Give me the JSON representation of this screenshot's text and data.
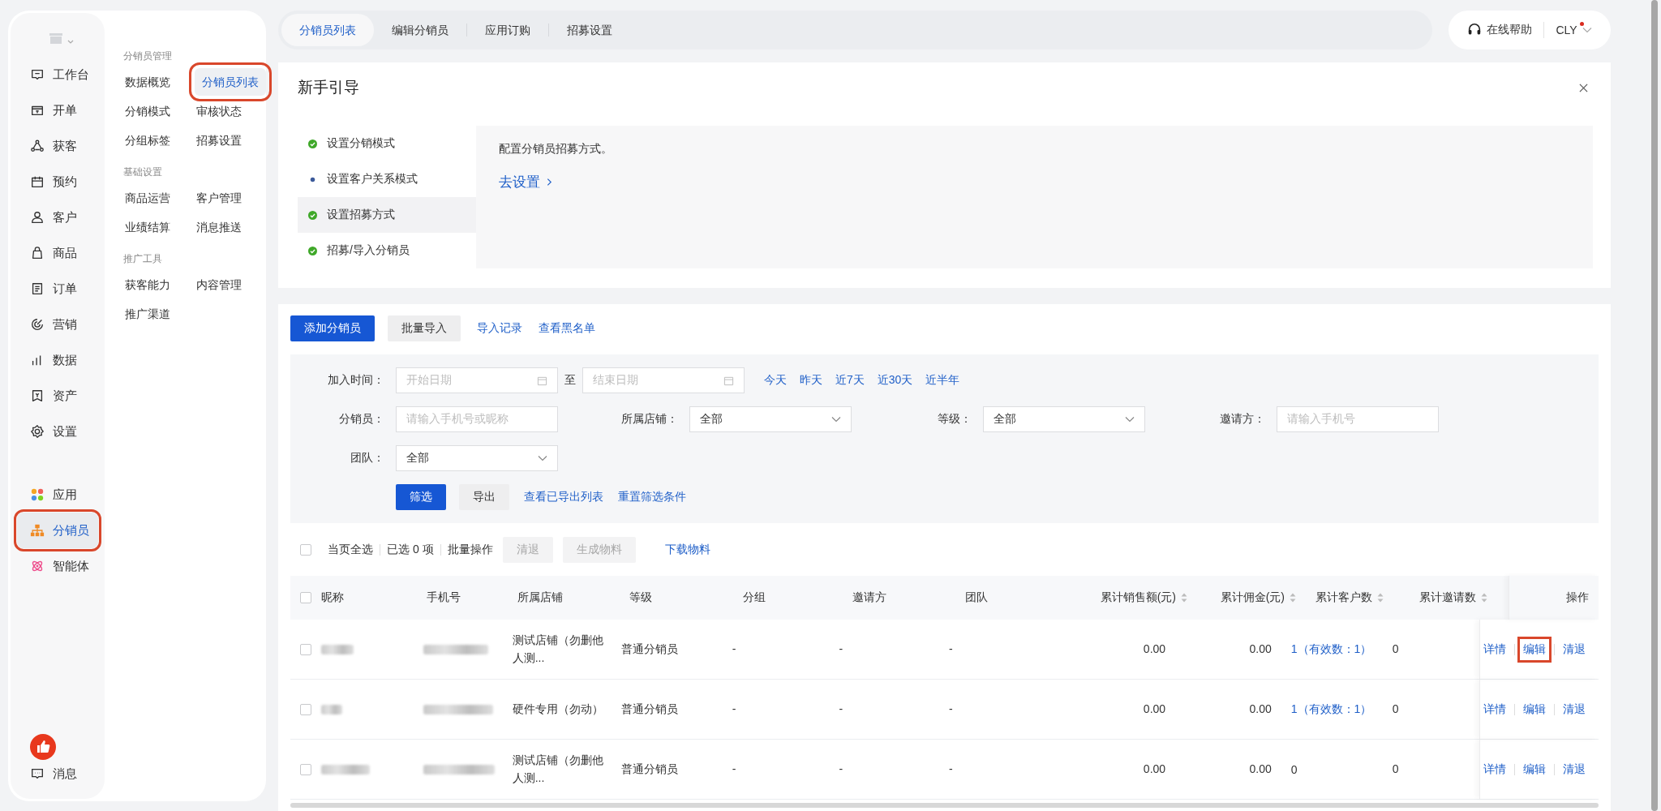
{
  "rail": {
    "items": [
      {
        "label": "工作台",
        "selected": false
      },
      {
        "label": "开单",
        "selected": false
      },
      {
        "label": "获客",
        "selected": false
      },
      {
        "label": "预约",
        "selected": false
      },
      {
        "label": "客户",
        "selected": false
      },
      {
        "label": "商品",
        "selected": false
      },
      {
        "label": "订单",
        "selected": false
      },
      {
        "label": "营销",
        "selected": false
      },
      {
        "label": "数据",
        "selected": false
      },
      {
        "label": "资产",
        "selected": false
      },
      {
        "label": "设置",
        "selected": false
      }
    ],
    "apps": [
      {
        "label": "应用",
        "selected": false,
        "highlighted": false
      },
      {
        "label": "分销员",
        "selected": true,
        "highlighted": true
      },
      {
        "label": "智能体",
        "selected": false,
        "highlighted": false
      }
    ],
    "messages": "消息"
  },
  "submenu": [
    {
      "title": "分销员管理",
      "items": [
        {
          "label": "数据概览",
          "selected": false,
          "highlighted": false
        },
        {
          "label": "分销员列表",
          "selected": true,
          "highlighted": true
        },
        {
          "label": "分销模式",
          "selected": false,
          "highlighted": false
        },
        {
          "label": "审核状态",
          "selected": false,
          "highlighted": false
        },
        {
          "label": "分组标签",
          "selected": false,
          "highlighted": false
        },
        {
          "label": "招募设置",
          "selected": false,
          "highlighted": false
        }
      ]
    },
    {
      "title": "基础设置",
      "items": [
        {
          "label": "商品运营",
          "selected": false,
          "highlighted": false
        },
        {
          "label": "客户管理",
          "selected": false,
          "highlighted": false
        },
        {
          "label": "业绩结算",
          "selected": false,
          "highlighted": false
        },
        {
          "label": "消息推送",
          "selected": false,
          "highlighted": false
        }
      ]
    },
    {
      "title": "推广工具",
      "items": [
        {
          "label": "获客能力",
          "selected": false,
          "highlighted": false
        },
        {
          "label": "内容管理",
          "selected": false,
          "highlighted": false
        },
        {
          "label": "推广渠道",
          "selected": false,
          "highlighted": false
        }
      ]
    }
  ],
  "tabs": [
    {
      "label": "分销员列表",
      "selected": true
    },
    {
      "label": "编辑分销员",
      "selected": false
    },
    {
      "label": "应用订购",
      "selected": false
    },
    {
      "label": "招募设置",
      "selected": false
    }
  ],
  "help": "在线帮助",
  "user": {
    "name": "CLY",
    "notification": true
  },
  "guide": {
    "title": "新手引导",
    "steps": [
      {
        "label": "设置分销模式",
        "done": true,
        "selected": false
      },
      {
        "label": "设置客户关系模式",
        "done": false,
        "selected": false
      },
      {
        "label": "设置招募方式",
        "done": true,
        "selected": true
      },
      {
        "label": "招募/导入分销员",
        "done": true,
        "selected": false
      }
    ],
    "description": "配置分销员招募方式。",
    "link": "去设置"
  },
  "toolbar": {
    "primary": "添加分销员",
    "secondary": "批量导入",
    "links": [
      "导入记录",
      "查看黑名单"
    ]
  },
  "filters": {
    "date": {
      "label": "加入时间：",
      "start_placeholder": "开始日期",
      "separator": "至",
      "end_placeholder": "结束日期",
      "quick": [
        "今天",
        "昨天",
        "近7天",
        "近30天",
        "近半年"
      ]
    },
    "fields": [
      {
        "label": "分销员：",
        "kind": "input",
        "placeholder": "请输入手机号或昵称"
      },
      {
        "label": "所属店铺：",
        "kind": "select",
        "value": "全部"
      },
      {
        "label": "等级：",
        "kind": "select",
        "value": "全部"
      },
      {
        "label": "邀请方：",
        "kind": "input",
        "placeholder": "请输入手机号"
      },
      {
        "label": "团队：",
        "kind": "select",
        "value": "全部"
      }
    ],
    "primary": "筛选",
    "secondary": "导出",
    "links": [
      "查看已导出列表",
      "重置筛选条件"
    ]
  },
  "batch": {
    "checked": false,
    "select_all": "当页全选",
    "selected_count": "已选 0 项",
    "batch_ops": "批量操作",
    "buttons": [
      {
        "label": "清退",
        "disabled": true
      },
      {
        "label": "生成物料",
        "disabled": true
      }
    ],
    "link": "下载物料"
  },
  "table": {
    "header_checked": false,
    "columns": [
      {
        "label": "昵称",
        "sortable": false
      },
      {
        "label": "手机号",
        "sortable": false
      },
      {
        "label": "所属店铺",
        "sortable": false
      },
      {
        "label": "等级",
        "sortable": false
      },
      {
        "label": "分组",
        "sortable": false
      },
      {
        "label": "邀请方",
        "sortable": false
      },
      {
        "label": "团队",
        "sortable": false
      },
      {
        "label": "累计销售额(元)",
        "sortable": true
      },
      {
        "label": "累计佣金(元)",
        "sortable": true
      },
      {
        "label": "累计客户数",
        "sortable": true
      },
      {
        "label": "累计邀请数",
        "sortable": true
      },
      {
        "label": "操作",
        "sortable": false
      }
    ],
    "rows": [
      {
        "checked": false,
        "store": "测试店铺（勿删他人测...",
        "level": "普通分销员",
        "group": "-",
        "inviter": "-",
        "team": "-",
        "sales": "0.00",
        "commission": "0.00",
        "customers": {
          "text": "1（有效数：1）",
          "kind": "link"
        },
        "invites": "0",
        "actions": [
          {
            "label": "详情",
            "highlighted": false
          },
          {
            "label": "编辑",
            "highlighted": true
          },
          {
            "label": "清退",
            "highlighted": false
          }
        ]
      },
      {
        "checked": false,
        "store": "硬件专用（勿动）",
        "level": "普通分销员",
        "group": "-",
        "inviter": "-",
        "team": "-",
        "sales": "0.00",
        "commission": "0.00",
        "customers": {
          "text": "1（有效数：1）",
          "kind": "link"
        },
        "invites": "0",
        "actions": [
          {
            "label": "详情",
            "highlighted": false
          },
          {
            "label": "编辑",
            "highlighted": false
          },
          {
            "label": "清退",
            "highlighted": false
          }
        ]
      },
      {
        "checked": false,
        "store": "测试店铺（勿删他人测...",
        "level": "普通分销员",
        "group": "-",
        "inviter": "-",
        "team": "-",
        "sales": "0.00",
        "commission": "0.00",
        "customers": {
          "text": "0",
          "kind": "text"
        },
        "invites": "0",
        "actions": [
          {
            "label": "详情",
            "highlighted": false
          },
          {
            "label": "编辑",
            "highlighted": false
          },
          {
            "label": "清退",
            "highlighted": false
          }
        ]
      }
    ]
  }
}
